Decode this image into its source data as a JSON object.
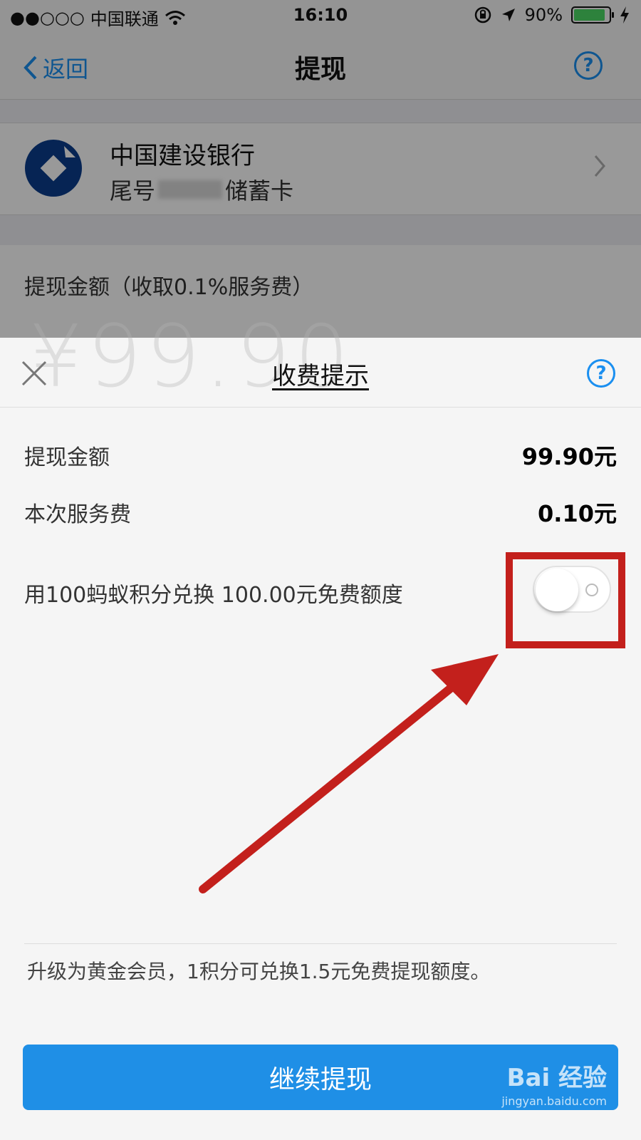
{
  "status_bar": {
    "signal": "●●○○○",
    "carrier": "中国联通",
    "wifi_icon": "wifi-icon",
    "time": "16:10",
    "rotation_lock_icon": "rotation-lock-icon",
    "location_icon": "location-arrow-icon",
    "battery_percent": "90%",
    "battery_level": 0.9,
    "battery_color": "#4cd964"
  },
  "nav": {
    "back_label": "返回",
    "title": "提现",
    "help_glyph": "?"
  },
  "bank": {
    "name": "中国建设银行",
    "tail_prefix": "尾号",
    "card_type": "储蓄卡",
    "logo_color": "#0a3d8c"
  },
  "amount": {
    "label": "提现金额（收取0.1%服务费）",
    "value": "¥99.90"
  },
  "sheet": {
    "title": "收费提示",
    "help_glyph": "?",
    "rows": [
      {
        "label": "提现金额",
        "value": "99.90元"
      },
      {
        "label": "本次服务费",
        "value": "0.10元"
      }
    ],
    "exchange_label": "用100蚂蚁积分兑换 100.00元免费额度",
    "exchange_toggle_on": false,
    "upgrade_note": "升级为黄金会员，1积分可兑换1.5元免费提现额度。",
    "continue_label": "继续提现"
  },
  "watermark": {
    "brand": "Bai 经验",
    "url": "jingyan.baidu.com"
  },
  "colors": {
    "accent": "#1a8ff0",
    "button": "#1f8fe6",
    "annotation": "#c3201c"
  }
}
